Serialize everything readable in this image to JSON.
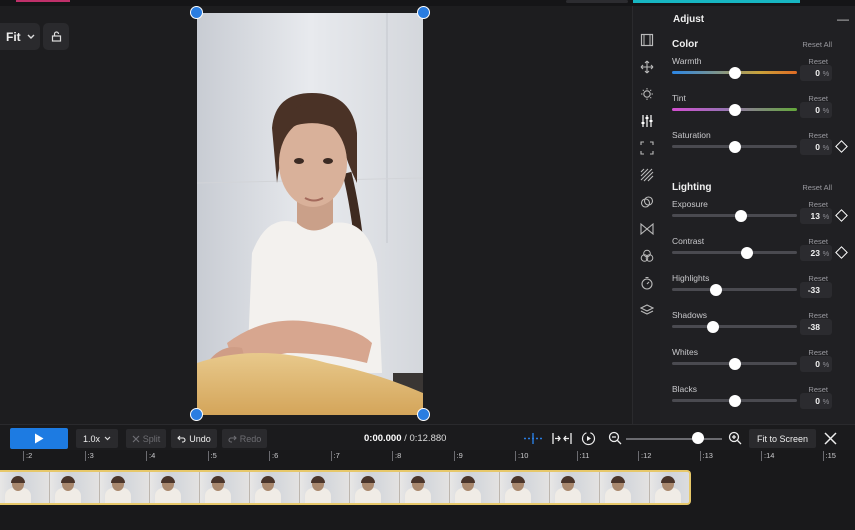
{
  "canvas": {
    "fit_label": "Fit"
  },
  "panel": {
    "title": "Adjust",
    "collapse_symbol": "—",
    "sections": [
      {
        "id": "color",
        "title": "Color",
        "reset_all": "Reset All",
        "rows": [
          {
            "label": "Warmth",
            "reset": "Reset",
            "value": "0",
            "unit": "%",
            "position": 0.5,
            "track": "warmth",
            "keyframe": false
          },
          {
            "label": "Tint",
            "reset": "Reset",
            "value": "0",
            "unit": "%",
            "position": 0.5,
            "track": "tint",
            "keyframe": false
          },
          {
            "label": "Saturation",
            "reset": "Reset",
            "value": "0",
            "unit": "%",
            "position": 0.5,
            "track": "plain",
            "keyframe": true
          }
        ]
      },
      {
        "id": "lighting",
        "title": "Lighting",
        "reset_all": "Reset All",
        "rows": [
          {
            "label": "Exposure",
            "reset": "Reset",
            "value": "13",
            "unit": "%",
            "position": 0.555,
            "track": "plain",
            "keyframe": true
          },
          {
            "label": "Contrast",
            "reset": "Reset",
            "value": "23",
            "unit": "%",
            "position": 0.6,
            "track": "plain",
            "keyframe": true
          },
          {
            "label": "Highlights",
            "reset": "Reset",
            "value": "-33",
            "unit": "",
            "position": 0.35,
            "track": "plain",
            "keyframe": false
          },
          {
            "label": "Shadows",
            "reset": "Reset",
            "value": "-38",
            "unit": "",
            "position": 0.325,
            "track": "plain",
            "keyframe": false
          },
          {
            "label": "Whites",
            "reset": "Reset",
            "value": "0",
            "unit": "%",
            "position": 0.5,
            "track": "plain",
            "keyframe": false
          },
          {
            "label": "Blacks",
            "reset": "Reset",
            "value": "0",
            "unit": "%",
            "position": 0.5,
            "track": "plain",
            "keyframe": false
          }
        ]
      }
    ]
  },
  "transport": {
    "speed": "1.0x",
    "split": "Split",
    "undo": "Undo",
    "redo": "Redo",
    "current_time": "0:00.000",
    "separator": "/",
    "duration": "0:12.880",
    "zoom_level": 0.75,
    "fit_to_screen": "Fit to Screen"
  },
  "timeline": {
    "ticks": [
      ":2",
      ":3",
      ":4",
      ":5",
      ":6",
      ":7",
      ":8",
      ":9",
      ":10",
      ":11",
      ":12",
      ":13",
      ":14",
      ":15"
    ],
    "frame_count": 14
  },
  "colors": {
    "accent": "#1d7be2",
    "clip_border": "#e7c86a",
    "top_accent": "#17b6c2"
  },
  "tools": [
    "film-icon",
    "move-icon",
    "bulb-icon",
    "sliders-icon",
    "crop-icon",
    "pattern-icon",
    "blend-icon",
    "transition-icon",
    "color-wheels-icon",
    "timer-icon",
    "layers-icon"
  ]
}
